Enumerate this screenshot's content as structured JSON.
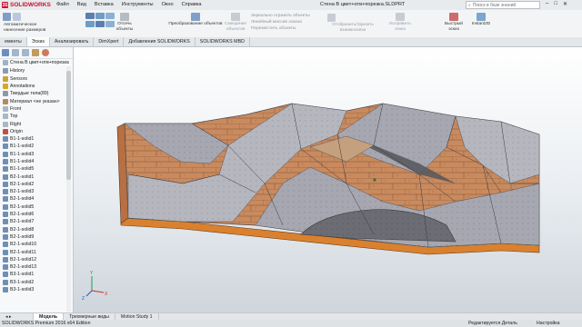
{
  "titlebar": {
    "logo_text": "SOLIDWORKS",
    "menu": [
      "Файл",
      "Вид",
      "Вставка",
      "Инструменты",
      "Окно",
      "Справка"
    ],
    "document_title": "Стена В цвет+отв+порезка.SLDPRT",
    "search_placeholder": "Поиск в базе знаний",
    "brand_color": "#c8102e"
  },
  "ribbon": {
    "autodim_label": "Автоматическое нанесение размеров",
    "convert_label": "Преобразование объектов",
    "offset_label": "Смещение объектов",
    "trim_label": "Отсечь объекты",
    "mirror_label": "Зеркально отразить объекты",
    "linear_pattern_label": "Линейный массив эскиза",
    "move_label": "Переместить объекты",
    "relations_label": "Отобразить/Удалить взаимосвязи",
    "repair_label": "Исправить эскиз",
    "quick_snaps_label": "Быстрый эскиз",
    "instant2d_label": "Instant2D"
  },
  "tabs": [
    "ементы",
    "Эскиз",
    "Анализировать",
    "DimXpert",
    "Добавления SOLIDWORKS",
    "SOLIDWORKS MBD"
  ],
  "active_tab_index": 1,
  "tree": {
    "root": "Стена В цвет+отв+порезка",
    "items": [
      {
        "label": "History",
        "icon": "history-icon"
      },
      {
        "label": "Sensors",
        "icon": "sensors-icon"
      },
      {
        "label": "Annotations",
        "icon": "annotations-icon"
      },
      {
        "label": "Твердые тела(89)",
        "icon": "solid-bodies-icon"
      },
      {
        "label": "Материал <не указан>",
        "icon": "material-icon"
      },
      {
        "label": "Front",
        "icon": "plane-icon"
      },
      {
        "label": "Top",
        "icon": "plane-icon"
      },
      {
        "label": "Right",
        "icon": "plane-icon"
      },
      {
        "label": "Origin",
        "icon": "origin-icon"
      },
      {
        "label": "B1-1-solid1",
        "icon": "body-icon"
      },
      {
        "label": "B1-1-solid2",
        "icon": "body-icon"
      },
      {
        "label": "B1-1-solid3",
        "icon": "body-icon"
      },
      {
        "label": "B1-1-solid4",
        "icon": "body-icon"
      },
      {
        "label": "B1-1-solid5",
        "icon": "body-icon"
      },
      {
        "label": "B2-1-solid1",
        "icon": "body-icon"
      },
      {
        "label": "B2-1-solid2",
        "icon": "body-icon"
      },
      {
        "label": "B2-1-solid3",
        "icon": "body-icon"
      },
      {
        "label": "B2-1-solid4",
        "icon": "body-icon"
      },
      {
        "label": "B2-1-solid5",
        "icon": "body-icon"
      },
      {
        "label": "B2-1-solid6",
        "icon": "body-icon"
      },
      {
        "label": "B2-1-solid7",
        "icon": "body-icon"
      },
      {
        "label": "B2-1-solid8",
        "icon": "body-icon"
      },
      {
        "label": "B2-1-solid9",
        "icon": "body-icon"
      },
      {
        "label": "B2-1-solid10",
        "icon": "body-icon"
      },
      {
        "label": "B2-1-solid11",
        "icon": "body-icon"
      },
      {
        "label": "B2-1-solid12",
        "icon": "body-icon"
      },
      {
        "label": "B2-1-solid13",
        "icon": "body-icon"
      },
      {
        "label": "B3-1-solid1",
        "icon": "body-icon"
      },
      {
        "label": "B3-1-solid2",
        "icon": "body-icon"
      },
      {
        "label": "B3-1-solid3",
        "icon": "body-icon"
      }
    ]
  },
  "viewport": {
    "brick_color": "#c98a5e",
    "stone_color": "#a6a7b0",
    "dark_color": "#6c6d74",
    "base_color": "#d9812f",
    "axis_labels": [
      "Y",
      "X",
      "Z"
    ]
  },
  "bottom_tabs": [
    "Модель",
    "Трехмерные виды",
    "Motion Study 1"
  ],
  "active_bottom_index": 0,
  "status": {
    "edition": "SOLIDWORKS Premium 2016 x64 Edition",
    "mode": "Редактируется Деталь",
    "settings": "Настройка"
  }
}
